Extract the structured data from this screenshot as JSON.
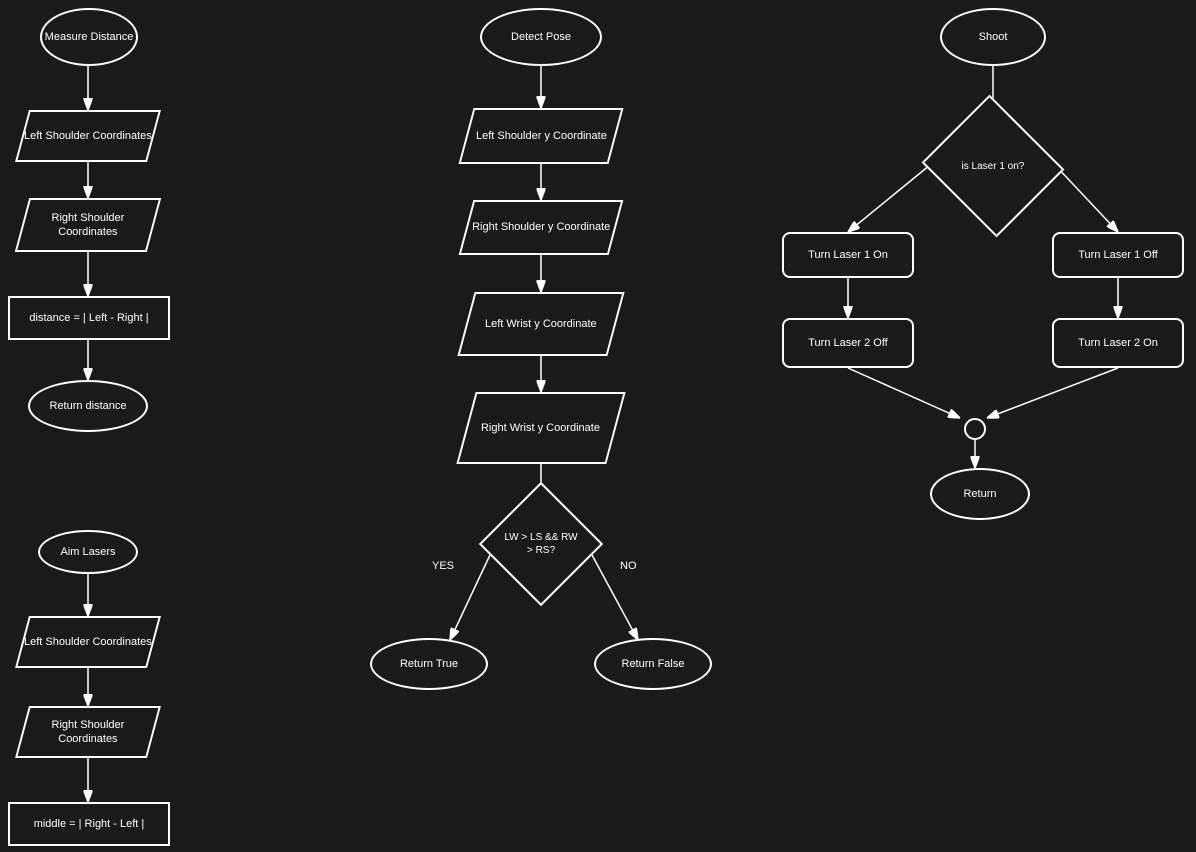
{
  "nodes": {
    "measure_distance": {
      "label": "Measure Distance"
    },
    "left_shoulder_coord": {
      "label": "Left Shoulder Coordinates"
    },
    "right_shoulder_coord1": {
      "label": "Right Shoulder Coordinates"
    },
    "distance_formula": {
      "label": "distance = | Left - Right |"
    },
    "return_distance": {
      "label": "Return distance"
    },
    "aim_lasers": {
      "label": "Aim Lasers"
    },
    "left_shoulder_coord2": {
      "label": "Left Shoulder Coordinates"
    },
    "right_shoulder_coord2": {
      "label": "Right Shoulder Coordinates"
    },
    "middle_formula": {
      "label": "middle = | Right - Left |"
    },
    "detect_pose": {
      "label": "Detect Pose"
    },
    "left_shoulder_y": {
      "label": "Left Shoulder y Coordinate"
    },
    "right_shoulder_y": {
      "label": "Right Shoulder y Coordinate"
    },
    "left_wrist_y": {
      "label": "Left Wrist y Coordinate"
    },
    "right_wrist_y": {
      "label": "Right Wrist y Coordinate"
    },
    "condition_lw_rw": {
      "label": "LW > LS && RW > RS?"
    },
    "return_true": {
      "label": "Return True"
    },
    "return_false": {
      "label": "Return False"
    },
    "shoot": {
      "label": "Shoot"
    },
    "is_laser1": {
      "label": "is Laser 1 on?"
    },
    "turn_laser1_on": {
      "label": "Turn Laser 1 On"
    },
    "turn_laser2_off": {
      "label": "Turn Laser 2 Off"
    },
    "turn_laser1_off": {
      "label": "Turn Laser 1 Off"
    },
    "turn_laser2_on": {
      "label": "Turn Laser 2 On"
    },
    "return_node": {
      "label": "Return"
    },
    "yes_label": {
      "label": "YES"
    },
    "no_label": {
      "label": "NO"
    }
  }
}
